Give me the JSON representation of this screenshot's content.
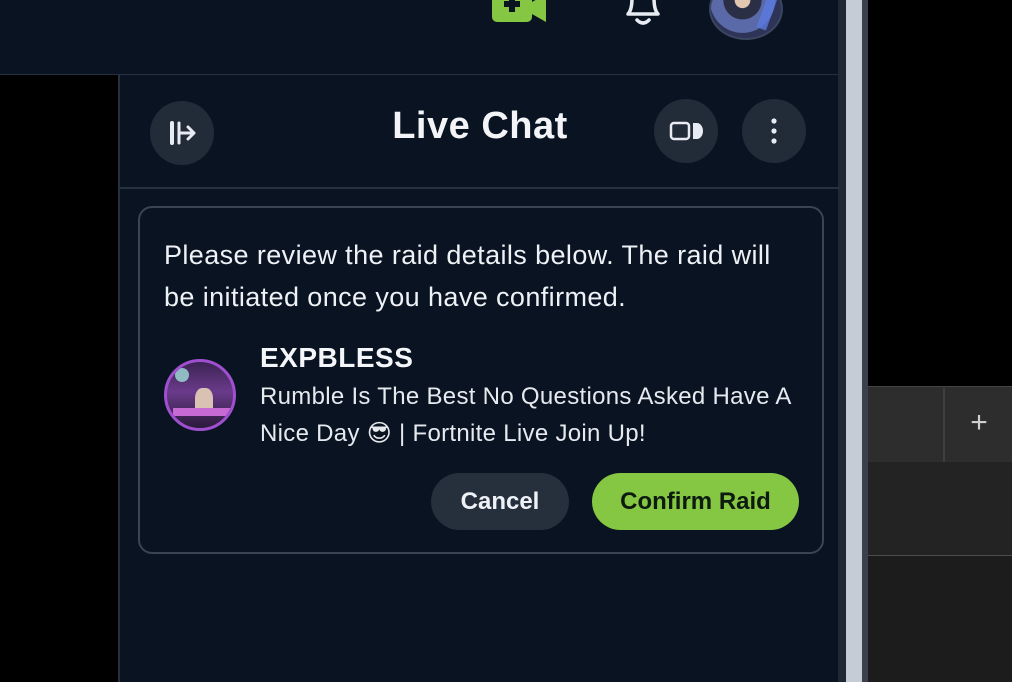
{
  "header": {
    "icons": [
      "go-live-camera-icon",
      "notifications-bell-icon"
    ],
    "avatar": "user-avatar"
  },
  "chat": {
    "title": "Live Chat",
    "icons": {
      "exit": "pop-out-exit-icon",
      "mode": "chat-mode-toggle-icon",
      "more": "more-vertical-icon"
    }
  },
  "raid": {
    "message": "Please review the raid details below. The raid will be initiated once you have confirmed.",
    "streamer_name": "EXPBLESS",
    "stream_title": "Rumble Is The Best No Questions Asked Have A Nice Day 😎 | Fortnite Live Join Up!",
    "cancel_label": "Cancel",
    "confirm_label": "Confirm Raid"
  },
  "background_app": {
    "new_tab_label": "+"
  },
  "colors": {
    "panel_bg": "#0a1321",
    "accent_green": "#85c742",
    "button_dark": "#26303d",
    "avatar_ring": "#a04fd0"
  }
}
